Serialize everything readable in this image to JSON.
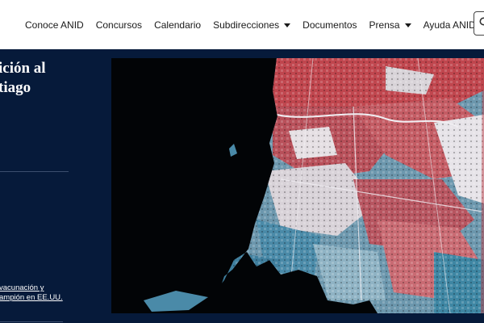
{
  "nav": {
    "items": [
      {
        "label": "Conoce ANID",
        "dropdown": false
      },
      {
        "label": "Concursos",
        "dropdown": false
      },
      {
        "label": "Calendario",
        "dropdown": false
      },
      {
        "label": "Subdirecciones",
        "dropdown": true
      },
      {
        "label": "Documentos",
        "dropdown": false
      },
      {
        "label": "Prensa",
        "dropdown": true
      },
      {
        "label": "Ayuda ANID",
        "dropdown": false
      }
    ],
    "search_icon": "search-icon"
  },
  "hero": {
    "title_line1": "ición al",
    "title_line2": "tiago",
    "related_link_line1": "vacunación y",
    "related_link_line2": "ampión en EE.UU."
  },
  "map": {
    "image_icon": "santiago-density-map",
    "colors": {
      "background": "#020406",
      "high": "#c0464e",
      "mid": "#e8e6ea",
      "low": "#3e86a3"
    }
  },
  "colors": {
    "navy": "#061a3a",
    "nav_text": "#1a1a1a"
  }
}
